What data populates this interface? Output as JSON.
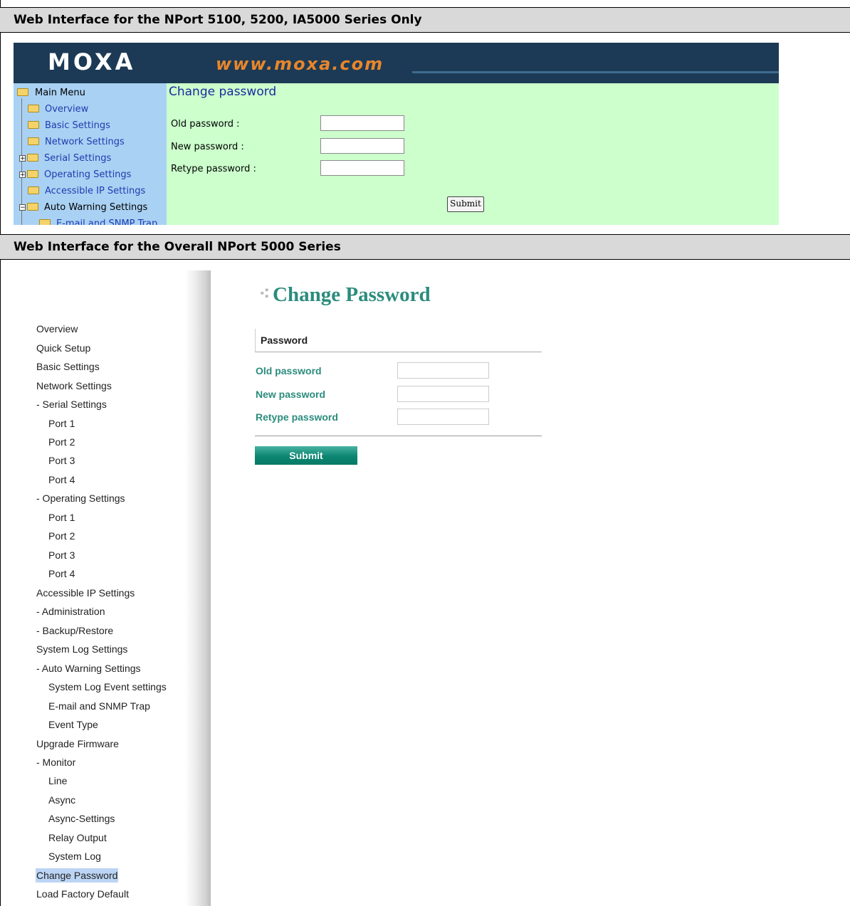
{
  "section1": {
    "header": "Web Interface for the NPort 5100, 5200, IA5000 Series Only",
    "banner": {
      "logo": "MOXA",
      "url": "www.moxa.com"
    },
    "menu": {
      "root": "Main Menu",
      "items": [
        "Overview",
        "Basic Settings",
        "Network Settings",
        "Serial Settings",
        "Operating Settings",
        "Accessible IP Settings",
        "Auto Warning Settings",
        "E-mail and SNMP Trap"
      ]
    },
    "form": {
      "title": "Change password",
      "old_label": "Old password :",
      "new_label": "New password :",
      "retype_label": "Retype password :",
      "submit": "Submit"
    }
  },
  "section2": {
    "header": "Web Interface for the Overall NPort 5000 Series",
    "menu": [
      "Overview",
      "Quick Setup",
      "Basic Settings",
      "Network Settings",
      "- Serial Settings",
      "Port 1",
      "Port 2",
      "Port 3",
      "Port 4",
      "- Operating Settings",
      "Port 1",
      "Port 2",
      "Port 3",
      "Port 4",
      "Accessible IP Settings",
      "- Administration",
      "- Backup/Restore",
      "System Log Settings",
      "- Auto Warning Settings",
      "System Log Event settings",
      "E-mail and SNMP Trap",
      "Event Type",
      "Upgrade Firmware",
      "- Monitor",
      "Line",
      "Async",
      "Async-Settings",
      "Relay Output",
      "System Log",
      "Change Password",
      "Load Factory Default"
    ],
    "form": {
      "title": "Change Password",
      "section_label": "Password",
      "old_label": "Old password",
      "new_label": "New password",
      "retype_label": "Retype password",
      "submit": "Submit"
    }
  },
  "colors": {
    "banner": "#1c3a55",
    "legacy_menu": "#a9d1f3",
    "legacy_main": "#ccffcc",
    "accent_teal": "#2b8c7d",
    "selected_item": "#bcd5f5"
  }
}
